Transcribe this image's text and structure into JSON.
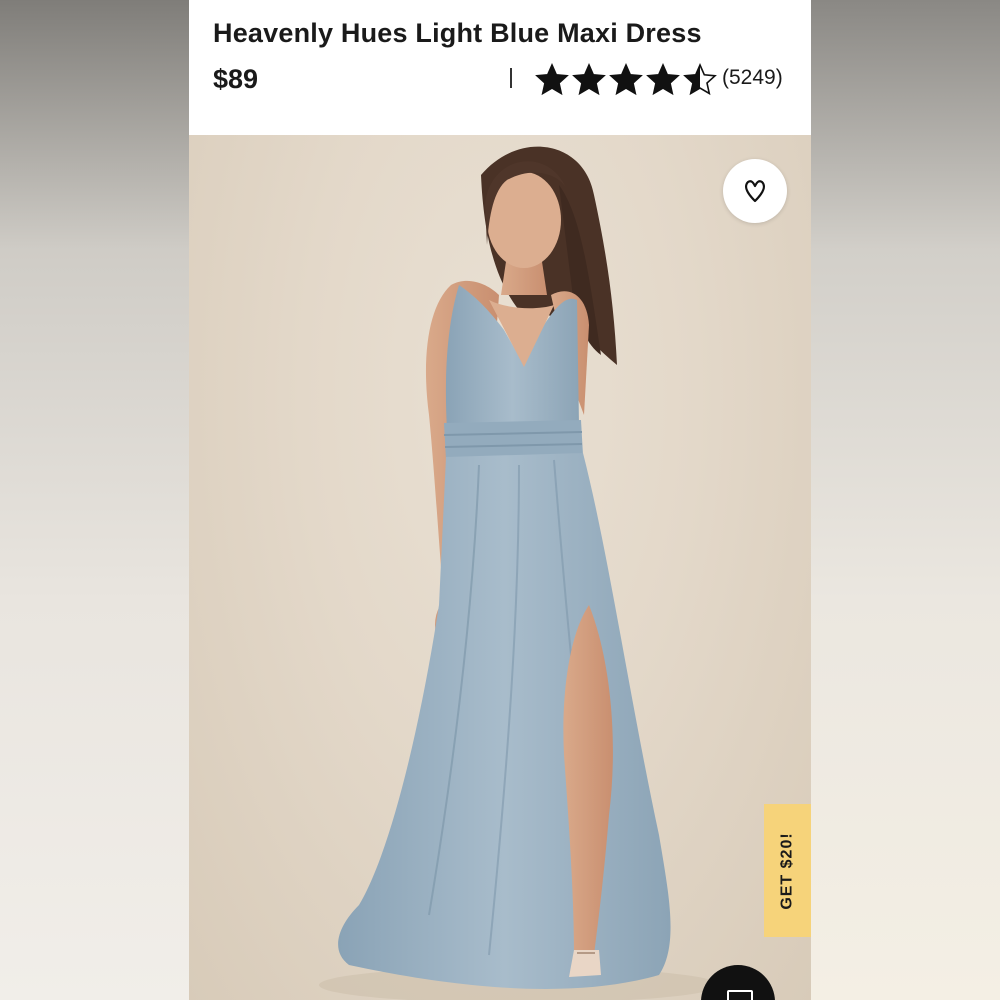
{
  "product": {
    "title": "Heavenly Hues Light Blue Maxi Dress",
    "price": "$89",
    "rating": 4.5,
    "rating_max": 5,
    "review_count": "(5249)"
  },
  "favorite_button": {
    "icon": "heart-icon"
  },
  "promo_tab": {
    "label": "GET $20!",
    "color": "#f6d37a"
  },
  "chat_button": {
    "icon": "chat-icon"
  },
  "colors": {
    "dress": "#9fb5c7",
    "accent": "#f6d37a",
    "text": "#1a1a1a"
  }
}
